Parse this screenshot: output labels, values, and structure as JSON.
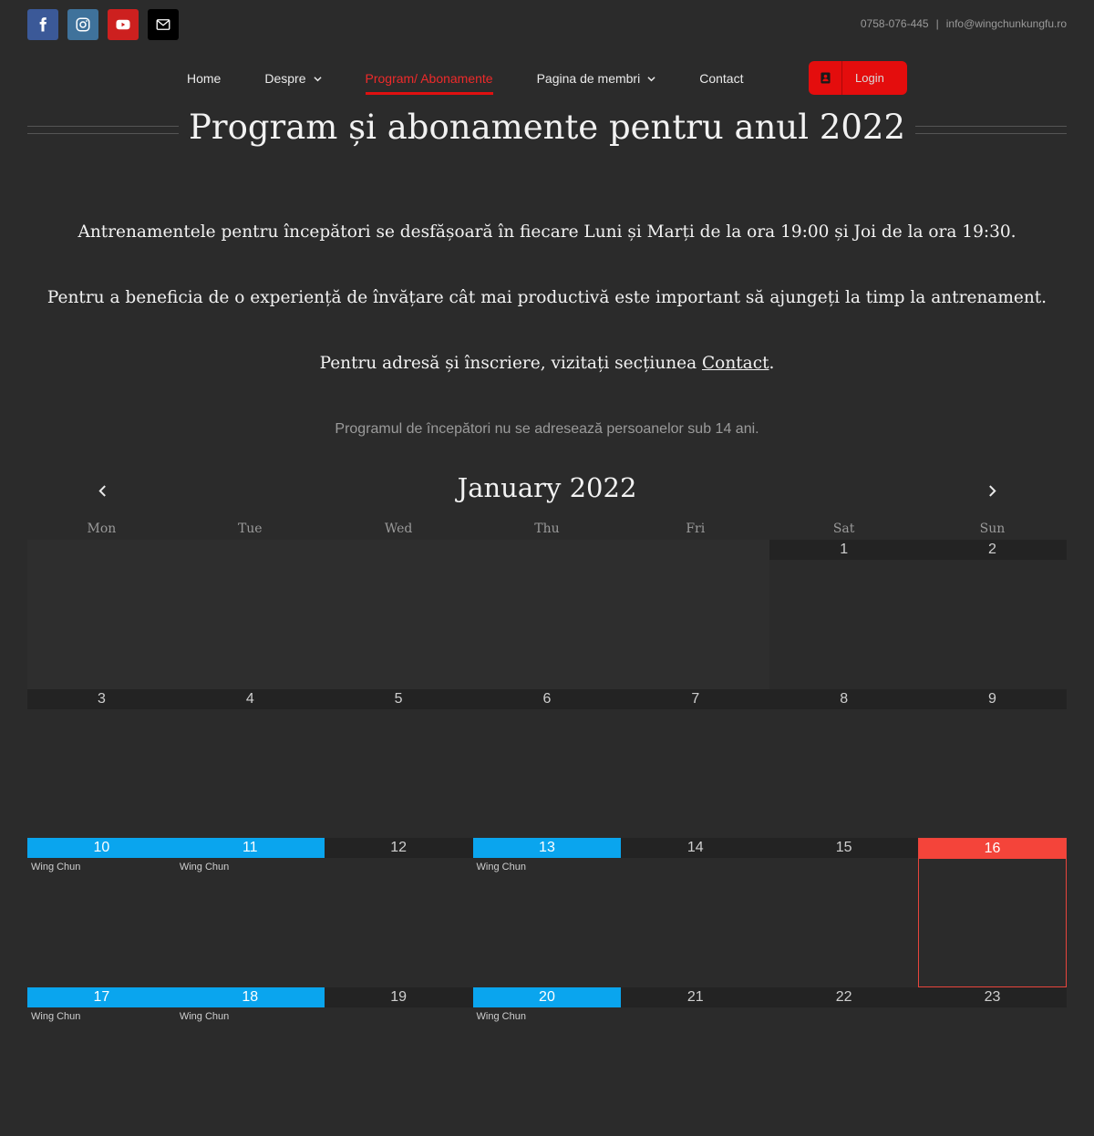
{
  "topbar": {
    "social": [
      {
        "name": "facebook-icon",
        "color": "#3b5998"
      },
      {
        "name": "instagram-icon",
        "color": "#3f729b"
      },
      {
        "name": "youtube-icon",
        "color": "#cd201f"
      },
      {
        "name": "email-icon",
        "color": "#000000"
      }
    ],
    "phone": "0758-076-445",
    "separator": "|",
    "email": "info@wingchunkungfu.ro"
  },
  "nav": {
    "items": [
      "Home",
      "Despre",
      "Program/ Abonamente",
      "Pagina de membri",
      "Contact"
    ],
    "login": "Login",
    "accent": "#e40d0d"
  },
  "page": {
    "title": "Program și abonamente pentru anul 2022",
    "para1": "Antrenamentele pentru începători se desfășoară în fiecare Luni și Marți de la ora 19:00 și Joi de la ora 19:30.",
    "para2": "Pentru a beneficia de o experiență de învățare cât mai productivă este important să ajungeți la timp la antrenament.",
    "para3_prefix": "Pentru adresă și înscriere, vizitați secțiunea ",
    "para3_link": "Contact",
    "para3_suffix": ".",
    "note": "Programul de începători nu se adresează persoanelor sub 14 ani."
  },
  "calendar": {
    "month_title": "January 2022",
    "days_of_week": [
      "Mon",
      "Tue",
      "Wed",
      "Thu",
      "Fri",
      "Sat",
      "Sun"
    ],
    "event_color": "#0aa5ee",
    "today_color": "#f4443a",
    "weeks": [
      [
        "",
        "",
        "",
        "",
        "",
        "1",
        "2"
      ],
      [
        "3",
        "4",
        "5",
        "6",
        "7",
        "8",
        "9"
      ],
      [
        "10",
        "11",
        "12",
        "13",
        "14",
        "15",
        "16"
      ],
      [
        "17",
        "18",
        "19",
        "20",
        "21",
        "22",
        "23"
      ]
    ],
    "events": {
      "10": "Wing Chun",
      "11": "Wing Chun",
      "13": "Wing Chun",
      "17": "Wing Chun",
      "18": "Wing Chun",
      "20": "Wing Chun"
    },
    "today": "16"
  }
}
